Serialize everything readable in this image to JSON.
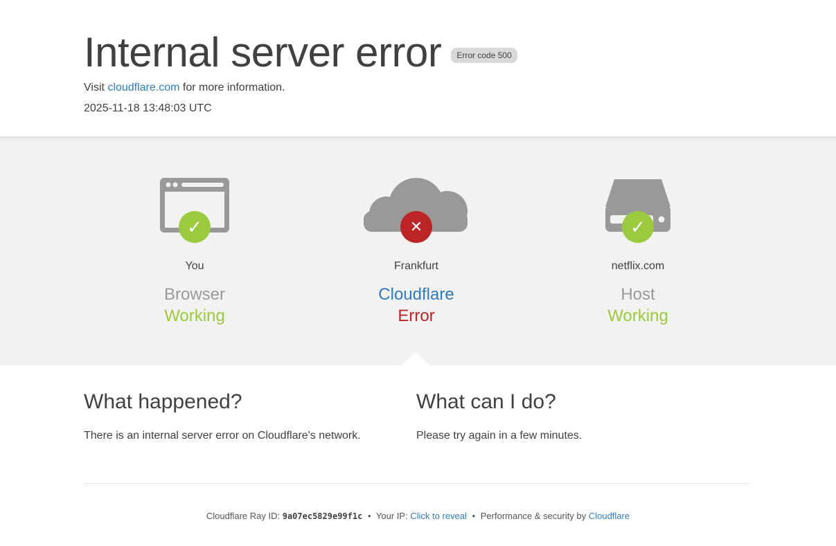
{
  "header": {
    "title": "Internal server error",
    "error_code_badge": "Error code 500",
    "visit_prefix": "Visit",
    "visit_link": "cloudflare.com",
    "visit_suffix": "for more information.",
    "timestamp": "2025-11-18 13:48:03 UTC"
  },
  "nodes": [
    {
      "icon": "browser-window-icon",
      "location": "You",
      "role": "Browser",
      "status": "Working",
      "status_type": "ok"
    },
    {
      "icon": "cloud-icon",
      "location": "Frankfurt",
      "role": "Cloudflare",
      "status": "Error",
      "status_type": "error"
    },
    {
      "icon": "server-icon",
      "location": "netflix.com",
      "role": "Host",
      "status": "Working",
      "status_type": "ok"
    }
  ],
  "what_happened": {
    "heading": "What happened?",
    "body": "There is an internal server error on Cloudflare's network."
  },
  "what_can_i_do": {
    "heading": "What can I do?",
    "body": "Please try again in a few minutes."
  },
  "footer": {
    "ray_label": "Cloudflare Ray ID:",
    "ray_id": "9a07ec5829e99f1c",
    "separator": "•",
    "ip_label": "Your IP:",
    "ip_link": "Click to reveal",
    "perf_label": "Performance & security by",
    "perf_link": "Cloudflare"
  },
  "colors": {
    "ok": "#9bca3e",
    "error": "#bd2426",
    "link": "#2f7bbf",
    "icon_gray": "#999999",
    "band": "#f2f2f2"
  }
}
